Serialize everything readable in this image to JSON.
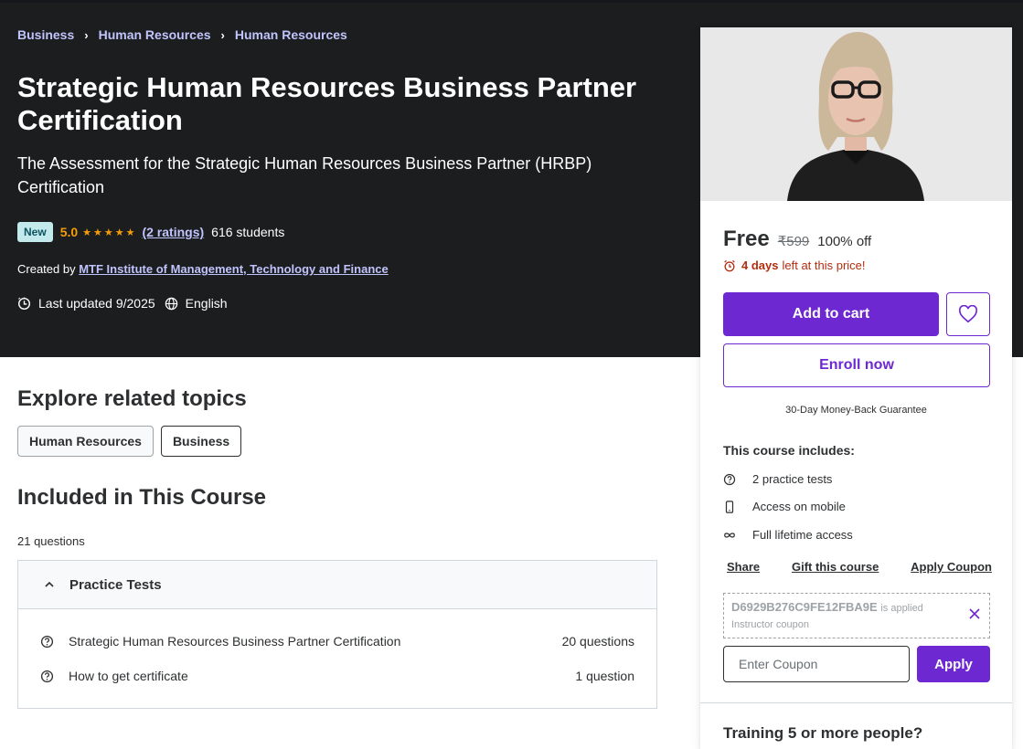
{
  "breadcrumb": [
    "Business",
    "Human Resources",
    "Human Resources"
  ],
  "course": {
    "title": "Strategic Human Resources Business Partner Certification",
    "subtitle": "The Assessment for the Strategic Human Resources Business Partner (HRBP) Certification",
    "badge": "New",
    "rating": "5.0",
    "rating_count": "(2 ratings)",
    "students": "616 students",
    "created_by_label": "Created by",
    "instructor": "MTF Institute of Management, Technology and Finance",
    "last_updated": "Last updated 9/2025",
    "language": "English"
  },
  "explore": {
    "title": "Explore related topics",
    "topics": [
      "Human Resources",
      "Business"
    ]
  },
  "included": {
    "title": "Included in This Course",
    "question_count": "21 questions",
    "section_title": "Practice Tests",
    "lectures": [
      {
        "title": "Strategic Human Resources Business Partner Certification",
        "count": "20 questions"
      },
      {
        "title": "How to get certificate",
        "count": "1 question"
      }
    ]
  },
  "sidebar": {
    "price": "Free",
    "old_price": "₹599",
    "discount": "100% off",
    "deadline_bold": "4 days",
    "deadline_rest": "left at this price!",
    "add_to_cart": "Add to cart",
    "enroll_now": "Enroll now",
    "guarantee": "30-Day Money-Back Guarantee",
    "includes_title": "This course includes:",
    "includes": [
      "2 practice tests",
      "Access on mobile",
      "Full lifetime access"
    ],
    "links": [
      "Share",
      "Gift this course",
      "Apply Coupon"
    ],
    "coupon_code": "D6929B276C9FE12FBA9E",
    "coupon_applied": "is applied",
    "coupon_type": "Instructor coupon",
    "coupon_placeholder": "Enter Coupon",
    "apply_label": "Apply",
    "training": "Training 5 or more people?"
  },
  "colors": {
    "hero_bg": "#1c1d1f",
    "accent": "#6d28d2",
    "link": "#c0c4fc",
    "star": "#f69c08",
    "warning": "#b32d0f"
  }
}
